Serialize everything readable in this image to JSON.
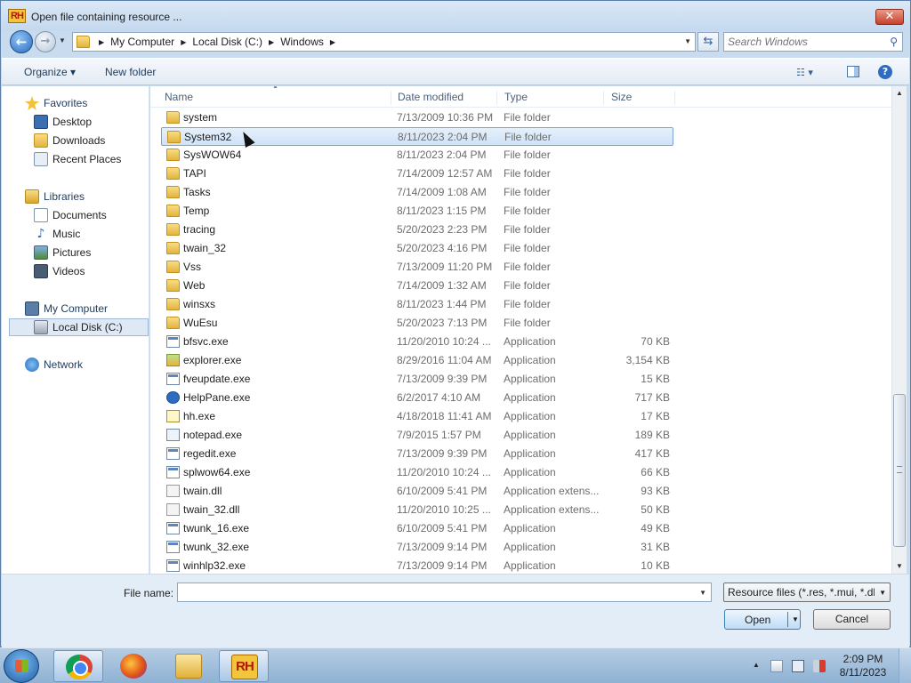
{
  "window": {
    "title": "Open file containing resource ...",
    "app_logo": "RH",
    "close_icon": "close-icon"
  },
  "address": {
    "crumbs": [
      "My Computer",
      "Local Disk (C:)",
      "Windows"
    ],
    "search_placeholder": "Search Windows"
  },
  "toolbar": {
    "organize": "Organize ▾",
    "new_folder": "New folder"
  },
  "navpane": {
    "favorites": "Favorites",
    "desktop": "Desktop",
    "downloads": "Downloads",
    "recent": "Recent Places",
    "libraries": "Libraries",
    "documents": "Documents",
    "music": "Music",
    "pictures": "Pictures",
    "videos": "Videos",
    "computer": "My Computer",
    "local_disk": "Local Disk (C:)",
    "network": "Network"
  },
  "columns": {
    "name": "Name",
    "date": "Date modified",
    "type": "Type",
    "size": "Size"
  },
  "files": [
    {
      "name": "system",
      "date": "7/13/2009 10:36 PM",
      "type": "File folder",
      "size": "",
      "icon": "folder"
    },
    {
      "name": "System32",
      "date": "8/11/2023 2:04 PM",
      "type": "File folder",
      "size": "",
      "icon": "folder"
    },
    {
      "name": "SysWOW64",
      "date": "8/11/2023 2:04 PM",
      "type": "File folder",
      "size": "",
      "icon": "folder"
    },
    {
      "name": "TAPI",
      "date": "7/14/2009 12:57 AM",
      "type": "File folder",
      "size": "",
      "icon": "folder"
    },
    {
      "name": "Tasks",
      "date": "7/14/2009 1:08 AM",
      "type": "File folder",
      "size": "",
      "icon": "folder"
    },
    {
      "name": "Temp",
      "date": "8/11/2023 1:15 PM",
      "type": "File folder",
      "size": "",
      "icon": "folder"
    },
    {
      "name": "tracing",
      "date": "5/20/2023 2:23 PM",
      "type": "File folder",
      "size": "",
      "icon": "folder"
    },
    {
      "name": "twain_32",
      "date": "5/20/2023 4:16 PM",
      "type": "File folder",
      "size": "",
      "icon": "folder"
    },
    {
      "name": "Vss",
      "date": "7/13/2009 11:20 PM",
      "type": "File folder",
      "size": "",
      "icon": "folder"
    },
    {
      "name": "Web",
      "date": "7/14/2009 1:32 AM",
      "type": "File folder",
      "size": "",
      "icon": "folder"
    },
    {
      "name": "winsxs",
      "date": "8/11/2023 1:44 PM",
      "type": "File folder",
      "size": "",
      "icon": "folder"
    },
    {
      "name": "WuEsu",
      "date": "5/20/2023 7:13 PM",
      "type": "File folder",
      "size": "",
      "icon": "folder"
    },
    {
      "name": "bfsvc.exe",
      "date": "11/20/2010 10:24 ...",
      "type": "Application",
      "size": "70 KB",
      "icon": "app"
    },
    {
      "name": "explorer.exe",
      "date": "8/29/2016 11:04 AM",
      "type": "Application",
      "size": "3,154 KB",
      "icon": "expl"
    },
    {
      "name": "fveupdate.exe",
      "date": "7/13/2009 9:39 PM",
      "type": "Application",
      "size": "15 KB",
      "icon": "app"
    },
    {
      "name": "HelpPane.exe",
      "date": "6/2/2017 4:10 AM",
      "type": "Application",
      "size": "717 KB",
      "icon": "help"
    },
    {
      "name": "hh.exe",
      "date": "4/18/2018 11:41 AM",
      "type": "Application",
      "size": "17 KB",
      "icon": "hh"
    },
    {
      "name": "notepad.exe",
      "date": "7/9/2015 1:57 PM",
      "type": "Application",
      "size": "189 KB",
      "icon": "note"
    },
    {
      "name": "regedit.exe",
      "date": "7/13/2009 9:39 PM",
      "type": "Application",
      "size": "417 KB",
      "icon": "app"
    },
    {
      "name": "splwow64.exe",
      "date": "11/20/2010 10:24 ...",
      "type": "Application",
      "size": "66 KB",
      "icon": "app"
    },
    {
      "name": "twain.dll",
      "date": "6/10/2009 5:41 PM",
      "type": "Application extens...",
      "size": "93 KB",
      "icon": "dll"
    },
    {
      "name": "twain_32.dll",
      "date": "11/20/2010 10:25 ...",
      "type": "Application extens...",
      "size": "50 KB",
      "icon": "dll"
    },
    {
      "name": "twunk_16.exe",
      "date": "6/10/2009 5:41 PM",
      "type": "Application",
      "size": "49 KB",
      "icon": "app"
    },
    {
      "name": "twunk_32.exe",
      "date": "7/13/2009 9:14 PM",
      "type": "Application",
      "size": "31 KB",
      "icon": "app"
    },
    {
      "name": "winhlp32.exe",
      "date": "7/13/2009 9:14 PM",
      "type": "Application",
      "size": "10 KB",
      "icon": "app"
    }
  ],
  "selected_index": 1,
  "bottom": {
    "file_name_label": "File name:",
    "file_name_value": "",
    "file_type": "Resource files (*.res, *.mui, *.dll",
    "open": "Open",
    "cancel": "Cancel"
  },
  "taskbar": {
    "time": "2:09 PM",
    "date": "8/11/2023",
    "rh_label": "RH"
  },
  "colors": {
    "selection": "#cfe2f8",
    "accent": "#2f6cc0"
  }
}
